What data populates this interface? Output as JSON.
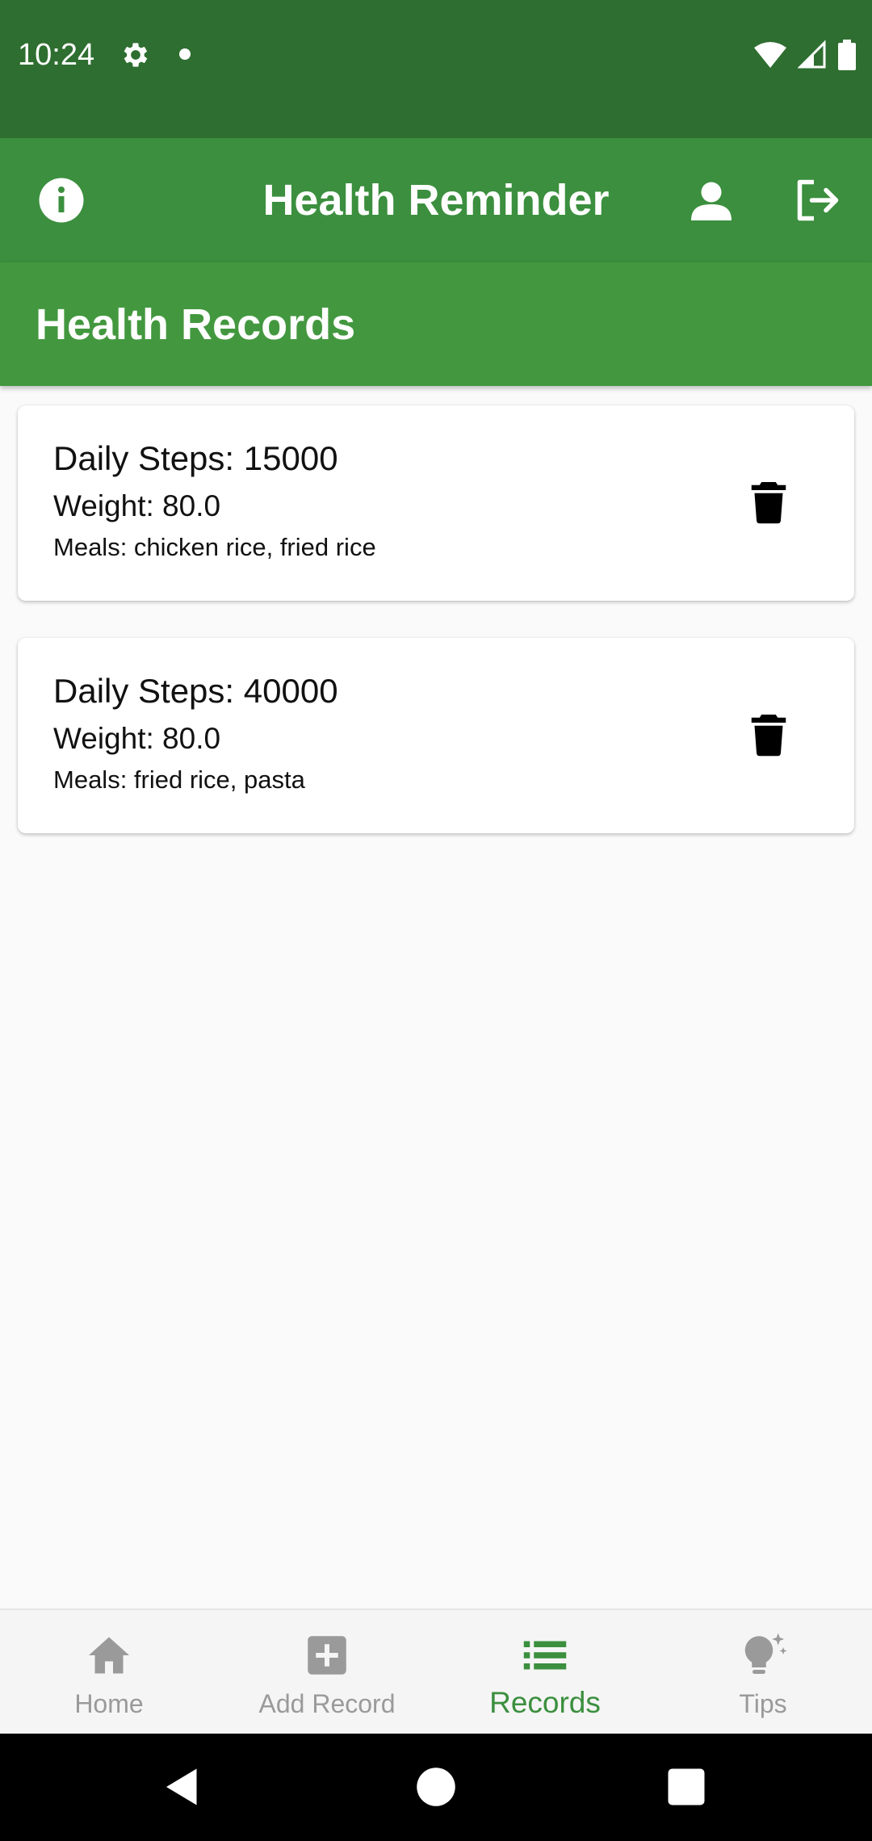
{
  "status_bar": {
    "time": "10:24",
    "icons": [
      "gear-icon",
      "notification-dot-icon",
      "wifi-icon",
      "signal-icon",
      "battery-icon"
    ]
  },
  "app_bar": {
    "title": "Health Reminder",
    "icons": [
      "info-icon",
      "person-icon",
      "logout-icon"
    ]
  },
  "section": {
    "title": "Health Records"
  },
  "records": [
    {
      "steps": "Daily Steps: 15000",
      "weight": "Weight: 80.0",
      "meals": "Meals: chicken rice, fried rice"
    },
    {
      "steps": "Daily Steps: 40000",
      "weight": "Weight: 80.0",
      "meals": "Meals: fried rice, pasta"
    }
  ],
  "bottom_nav": {
    "items": [
      {
        "label": "Home",
        "icon": "home-icon",
        "active": false
      },
      {
        "label": "Add Record",
        "icon": "add-box-icon",
        "active": false
      },
      {
        "label": "Records",
        "icon": "list-icon",
        "active": true
      },
      {
        "label": "Tips",
        "icon": "lightbulb-icon",
        "active": false
      }
    ]
  },
  "colors": {
    "status_bar": "#2e6e30",
    "app_bar": "#3b8f3e",
    "section_header": "#43983f",
    "active_nav": "#3b8f3e",
    "inactive_nav": "#9a9a9a"
  }
}
